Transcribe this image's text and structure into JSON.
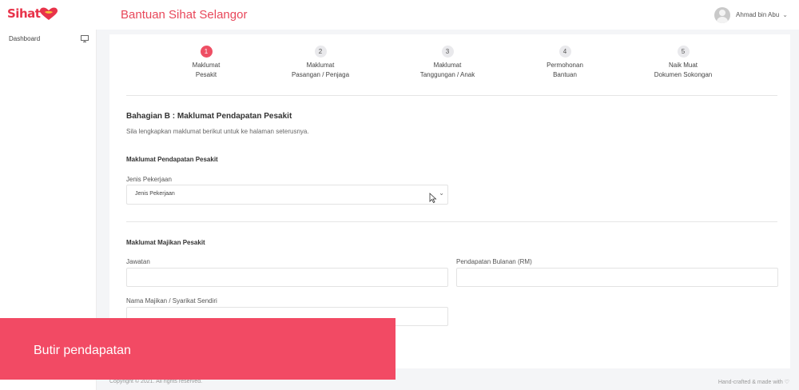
{
  "app": {
    "logo_text": "Sihat",
    "title": "Bantuan Sihat Selangor",
    "user_name": "Ahmad bin Abu"
  },
  "sidebar": {
    "items": [
      {
        "label": "Dashboard",
        "icon": "monitor-icon"
      }
    ]
  },
  "stepper": {
    "steps": [
      {
        "number": "1",
        "line1": "Maklumat",
        "line2": "Pesakit",
        "active": true
      },
      {
        "number": "2",
        "line1": "Maklumat",
        "line2": "Pasangan / Penjaga",
        "active": false
      },
      {
        "number": "3",
        "line1": "Maklumat",
        "line2": "Tanggungan / Anak",
        "active": false
      },
      {
        "number": "4",
        "line1": "Permohonan",
        "line2": "Bantuan",
        "active": false
      },
      {
        "number": "5",
        "line1": "Naik Muat",
        "line2": "Dokumen Sokongan",
        "active": false
      }
    ]
  },
  "form": {
    "heading": "Bahagian B : Maklumat Pendapatan Pesakit",
    "subtitle": "Sila lengkapkan maklumat berikut untuk ke halaman seterusnya.",
    "income_section": {
      "title": "Maklumat Pendapatan Pesakit",
      "job_type_label": "Jenis Pekerjaan",
      "job_type_selected": "Jenis Pekerjaan"
    },
    "employer_section": {
      "title": "Maklumat Majikan Pesakit",
      "position_label": "Jawatan",
      "position_value": "",
      "monthly_income_label": "Pendapatan Bulanan (RM)",
      "monthly_income_value": "",
      "employer_name_label": "Nama Majikan / Syarikat Sendiri",
      "employer_name_value": ""
    }
  },
  "footer": {
    "copyright": "Copyright © 2021. All rights reserved.",
    "credit": "Hand-crafted & made with ♡"
  },
  "overlay": {
    "caption": "Butir pendapatan"
  },
  "colors": {
    "accent": "#ee4f64",
    "title": "#e8475a",
    "banner": "#f24a64"
  }
}
